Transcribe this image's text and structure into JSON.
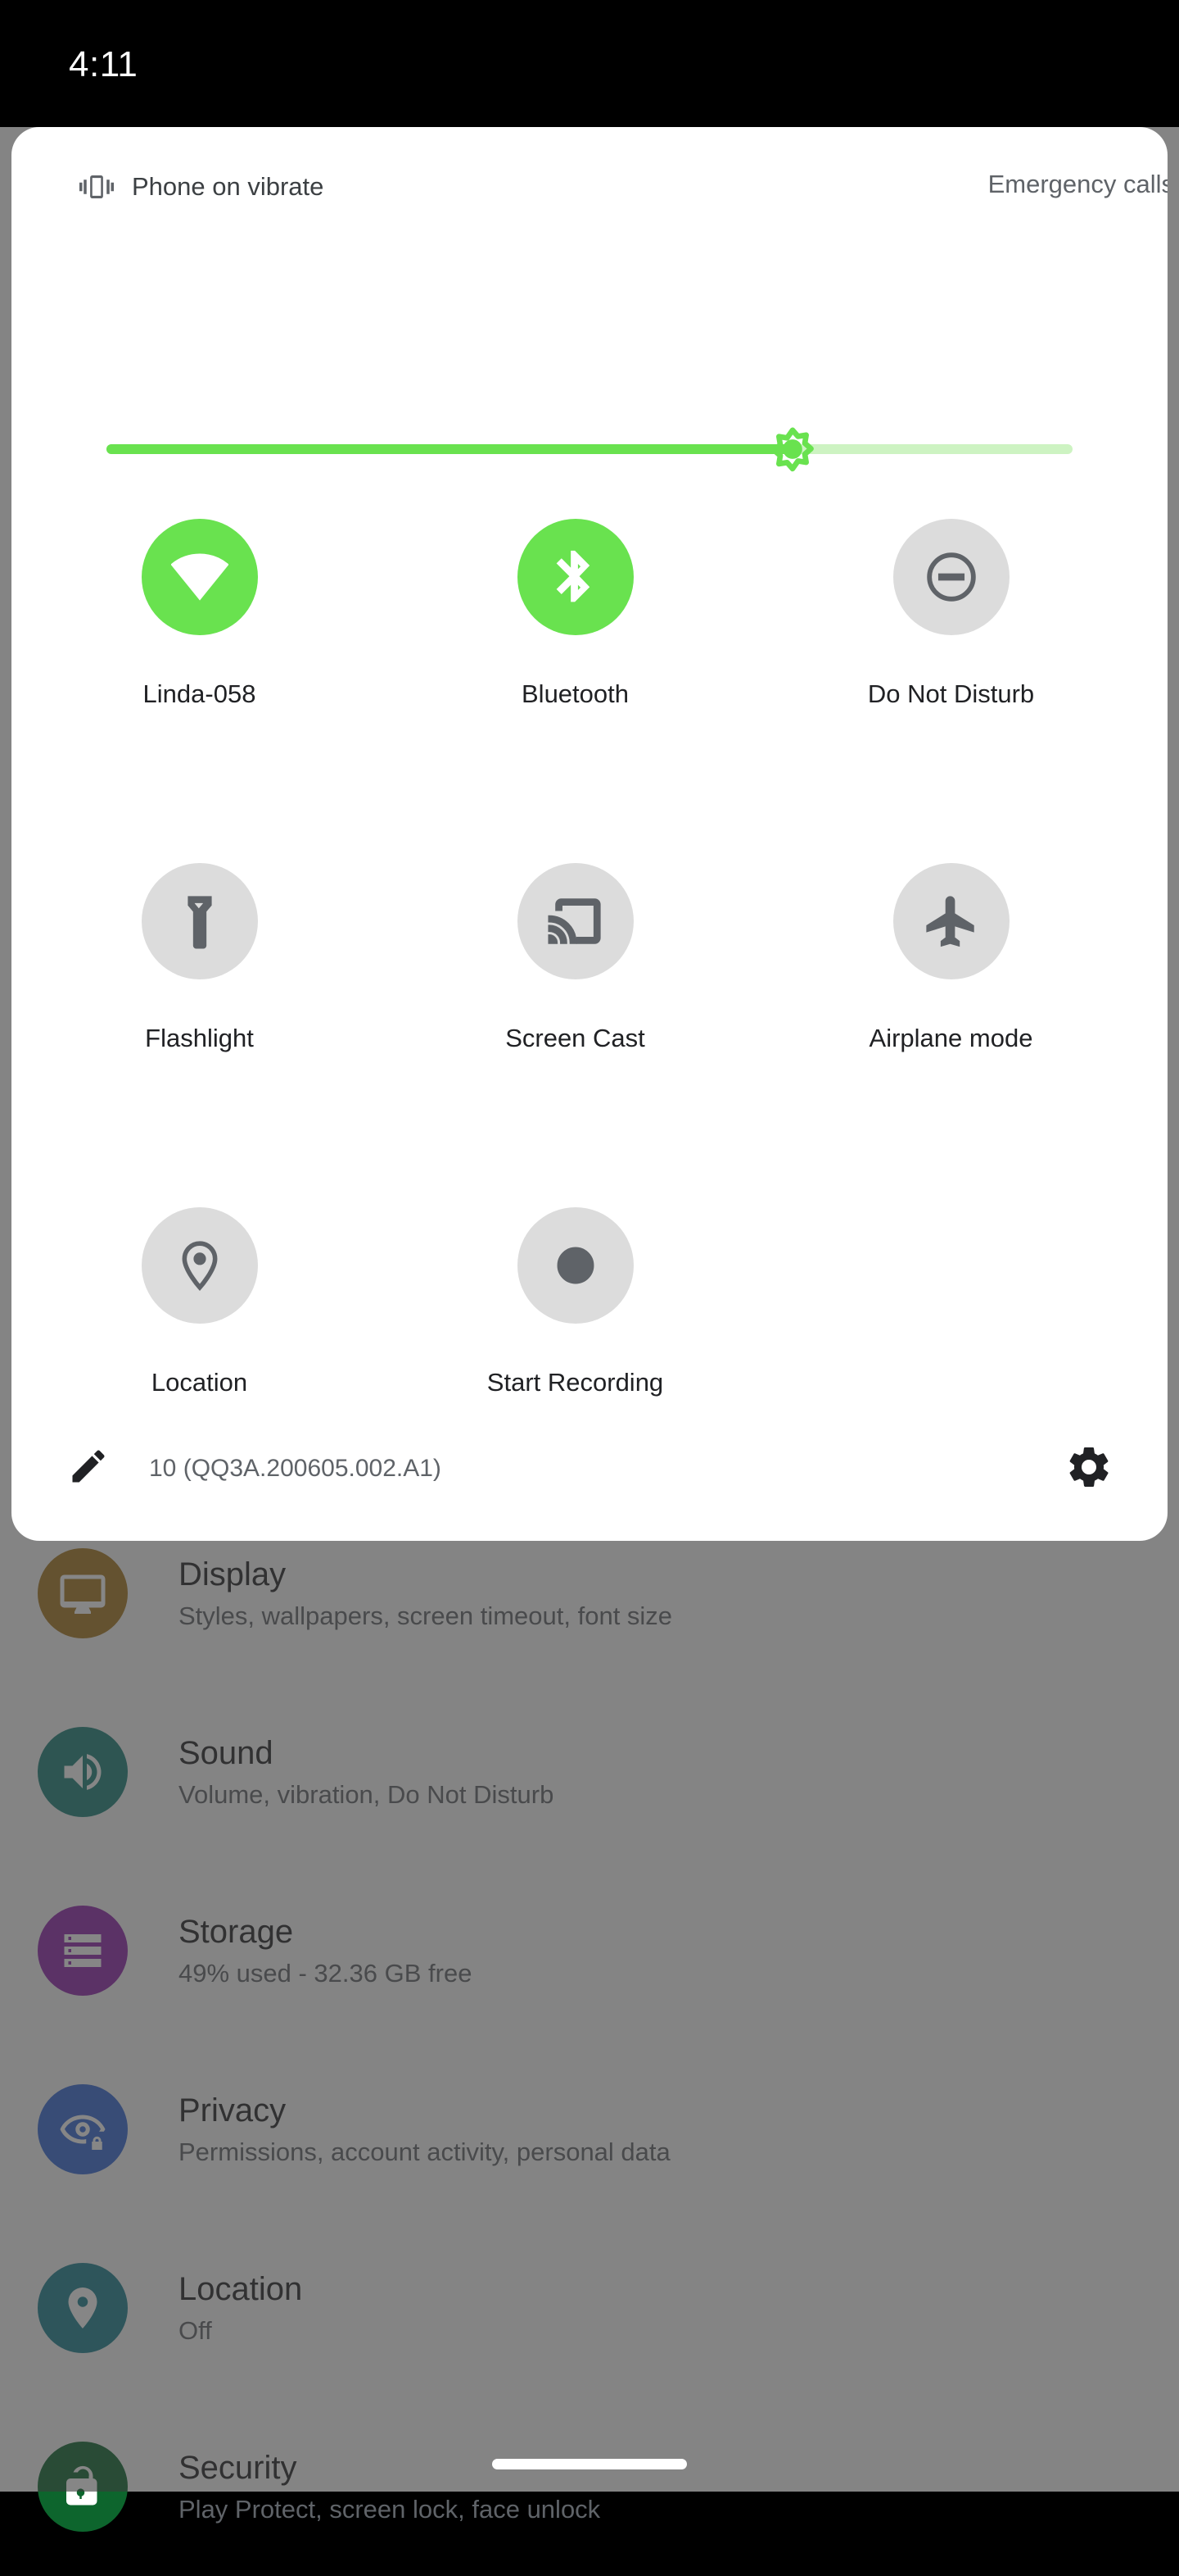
{
  "status_bar": {
    "time": "4:11"
  },
  "quick_settings": {
    "header": {
      "ringer_status": "Phone on vibrate",
      "ringer_icon": "vibrate-icon",
      "carrier_status": "Emergency calls"
    },
    "brightness": {
      "name": "Brightness",
      "icon": "brightness-sun-icon",
      "value_percent": 71,
      "fill_color": "#69e24f",
      "track_color": "#cdf3c2"
    },
    "active_color": "#69e24f",
    "inactive_color": "#dcdcdc",
    "tiles": [
      [
        {
          "label": "Linda-058",
          "icon": "wifi-icon",
          "state": "on"
        },
        {
          "label": "Bluetooth",
          "icon": "bluetooth-icon",
          "state": "on"
        },
        {
          "label": "Do Not Disturb",
          "icon": "do-not-disturb-icon",
          "state": "off"
        }
      ],
      [
        {
          "label": "Flashlight",
          "icon": "flashlight-icon",
          "state": "off"
        },
        {
          "label": "Screen Cast",
          "icon": "cast-icon",
          "state": "off"
        },
        {
          "label": "Airplane mode",
          "icon": "airplane-icon",
          "state": "off"
        }
      ],
      [
        {
          "label": "Location",
          "icon": "location-pin-icon",
          "state": "off"
        },
        {
          "label": "Start Recording",
          "icon": "record-circle-icon",
          "state": "off"
        },
        {
          "label": "",
          "icon": "",
          "state": "empty"
        }
      ]
    ],
    "footer": {
      "edit_icon": "pencil-edit-icon",
      "build_number": "10 (QQ3A.200605.002.A1)",
      "settings_icon": "gear-icon"
    }
  },
  "settings_page": {
    "items": [
      {
        "title": "Display",
        "subtitle": "Styles, wallpapers, screen timeout, font size",
        "icon": "display-icon",
        "icon_color": "#a6761d"
      },
      {
        "title": "Sound",
        "subtitle": "Volume, vibration, Do Not Disturb",
        "icon": "sound-icon",
        "icon_color": "#1a7f78"
      },
      {
        "title": "Storage",
        "subtitle": "49% used - 32.36 GB free",
        "icon": "storage-icon",
        "icon_color": "#8e24aa"
      },
      {
        "title": "Privacy",
        "subtitle": "Permissions, account activity, personal data",
        "icon": "privacy-icon",
        "icon_color": "#3367d6"
      },
      {
        "title": "Location",
        "subtitle": "Off",
        "icon": "location-icon",
        "icon_color": "#1a7f8e"
      },
      {
        "title": "Security",
        "subtitle": "Play Protect, screen lock, face unlock",
        "icon": "security-icon",
        "icon_color": "#0d652d"
      }
    ]
  },
  "navigation": {
    "pill": "home-gesture-pill"
  }
}
